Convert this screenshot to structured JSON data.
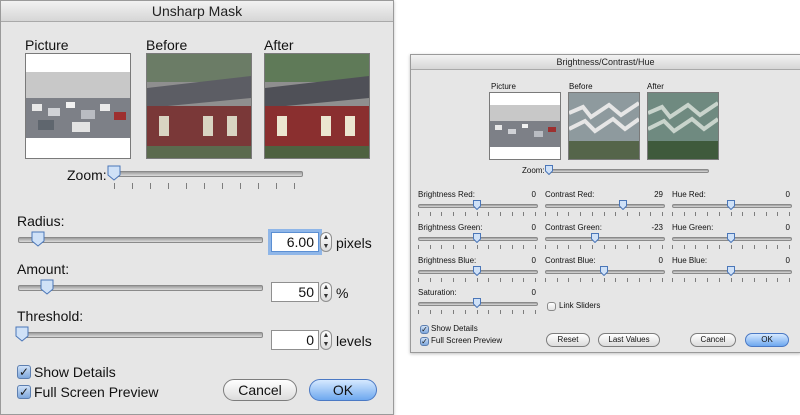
{
  "unsharp": {
    "title": "Unsharp Mask",
    "previews": {
      "picture": "Picture",
      "before": "Before",
      "after": "After"
    },
    "zoom_label": "Zoom:",
    "radius": {
      "label": "Radius:",
      "value": "6.00",
      "unit": "pixels",
      "level": 0.08
    },
    "amount": {
      "label": "Amount:",
      "value": "50",
      "unit": "%",
      "level": 0.1
    },
    "threshold": {
      "label": "Threshold:",
      "value": "0",
      "unit": "levels",
      "level": 0.0
    },
    "show_details": "Show Details",
    "full_screen": "Full Screen Preview",
    "cancel": "Cancel",
    "ok": "OK"
  },
  "bch": {
    "title": "Brightness/Contrast/Hue",
    "previews": {
      "picture": "Picture",
      "before": "Before",
      "after": "After"
    },
    "zoom_label": "Zoom:",
    "sliders": [
      {
        "label": "Brightness Red:",
        "value": "0"
      },
      {
        "label": "Contrast Red:",
        "value": "29"
      },
      {
        "label": "Hue Red:",
        "value": "0"
      },
      {
        "label": "Brightness Green:",
        "value": "0"
      },
      {
        "label": "Contrast Green:",
        "value": "-23"
      },
      {
        "label": "Hue Green:",
        "value": "0"
      },
      {
        "label": "Brightness Blue:",
        "value": "0"
      },
      {
        "label": "Contrast Blue:",
        "value": "0"
      },
      {
        "label": "Hue Blue:",
        "value": "0"
      },
      {
        "label": "Saturation:",
        "value": "0"
      }
    ],
    "link_sliders": "Link Sliders",
    "show_details": "Show Details",
    "full_screen": "Full Screen Preview",
    "reset": "Reset",
    "last_values": "Last Values",
    "cancel": "Cancel",
    "ok": "OK"
  },
  "colors": {
    "default_button": "#6ea8ef",
    "focus_ring": "#8fb6e8",
    "window_bg": "#e6e6e6"
  }
}
